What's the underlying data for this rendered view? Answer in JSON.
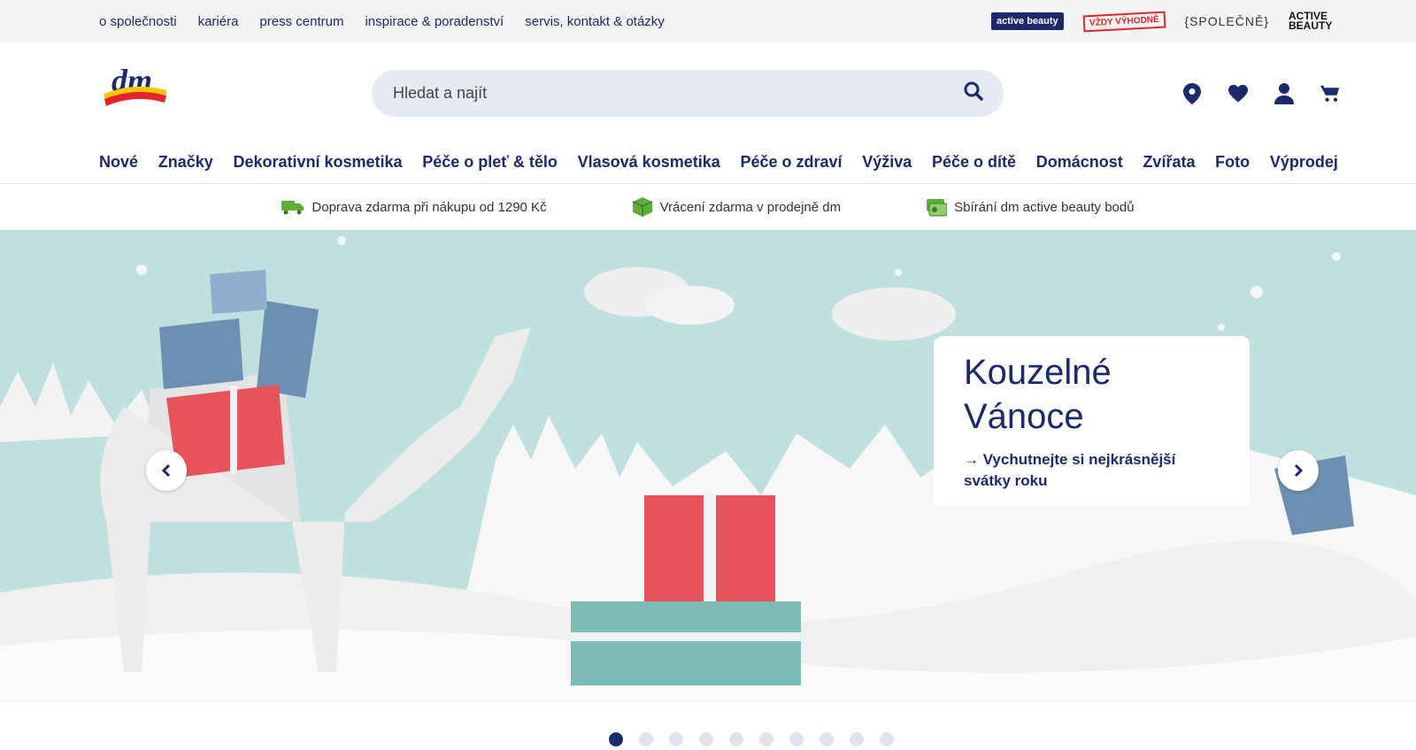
{
  "topbar": {
    "links": [
      "o společnosti",
      "kariéra",
      "press centrum",
      "inspirace & poradenství",
      "servis, kontakt & otázky"
    ],
    "partners": {
      "active_beauty": "active beauty",
      "vzdy_vyhodne": "VŽDY VÝHODNĚ",
      "spolecne": "{SPOLEČNĚ}",
      "active_beauty_2": "ACTIVE BEAUTY"
    }
  },
  "header": {
    "logo": "dm",
    "search_placeholder": "Hledat a najít"
  },
  "nav": [
    "Nové",
    "Značky",
    "Dekorativní kosmetika",
    "Péče o pleť & tělo",
    "Vlasová kosmetika",
    "Péče o zdraví",
    "Výživa",
    "Péče o dítě",
    "Domácnost",
    "Zvířata",
    "Foto",
    "Výprodej"
  ],
  "usp": [
    "Doprava zdarma při nákupu od 1290 Kč",
    "Vrácení zdarma v prodejně dm",
    "Sbírání dm active beauty bodů"
  ],
  "hero": {
    "title": "Kouzelné Vánoce",
    "link": "→ Vychutnejte si nejkrásnější svátky roku"
  },
  "carousel": {
    "slide_count": 10,
    "active_index": 0
  },
  "colors": {
    "brand": "#1a2a6c",
    "accent_red": "#e2242b",
    "hero_bg": "#bfe0df",
    "usp_green": "#5fae3b"
  }
}
